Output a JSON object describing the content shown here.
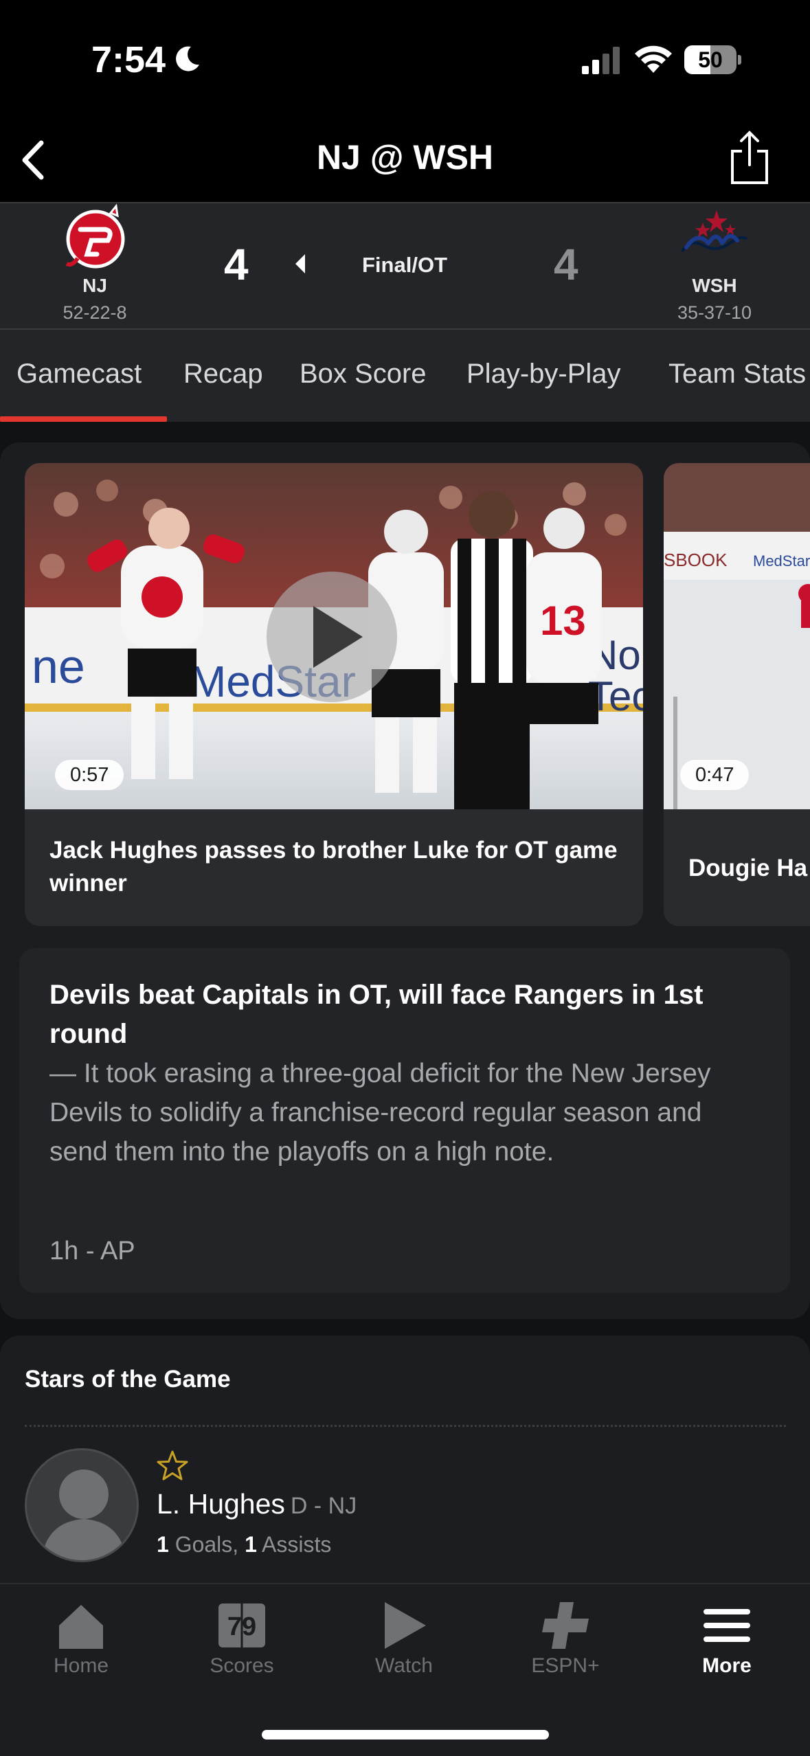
{
  "status_bar": {
    "time": "7:54",
    "battery": "50",
    "battery_level": 0.5
  },
  "nav": {
    "title": "NJ @ WSH"
  },
  "scoreboard": {
    "away": {
      "abbr": "NJ",
      "record": "52-22-8",
      "score": "4",
      "color": "#ce1126"
    },
    "home": {
      "abbr": "WSH",
      "record": "35-37-10",
      "score": "4",
      "color": "#041e42"
    },
    "status": "Final/OT"
  },
  "tabs": [
    {
      "label": "Gamecast",
      "active": true
    },
    {
      "label": "Recap"
    },
    {
      "label": "Box Score"
    },
    {
      "label": "Play-by-Play"
    },
    {
      "label": "Team Stats"
    }
  ],
  "videos": [
    {
      "duration": "0:57",
      "title": "Jack Hughes passes to brother Luke for OT game winner"
    },
    {
      "duration": "0:47",
      "title": "Dougie Ha"
    }
  ],
  "article": {
    "headline": "Devils beat Capitals in OT, will face Rangers in 1st round",
    "summary": "— It took erasing a three-goal deficit for the New Jersey Devils to solidify a franchise-record regular season and send them into the playoffs on a high note.",
    "meta": "1h - AP"
  },
  "stars": {
    "title": "Stars of the Game",
    "players": [
      {
        "name": "L. Hughes",
        "position": "D - NJ",
        "goals": "1",
        "goals_label": "Goals,",
        "assists": "1",
        "assists_label": "Assists"
      }
    ]
  },
  "tabbar": [
    {
      "label": "Home",
      "icon": "home-icon"
    },
    {
      "label": "Scores",
      "icon": "scores-icon",
      "icon_text": "79"
    },
    {
      "label": "Watch",
      "icon": "play-icon"
    },
    {
      "label": "ESPN+",
      "icon": "plus-icon"
    },
    {
      "label": "More",
      "icon": "menu-icon",
      "active": true
    }
  ]
}
